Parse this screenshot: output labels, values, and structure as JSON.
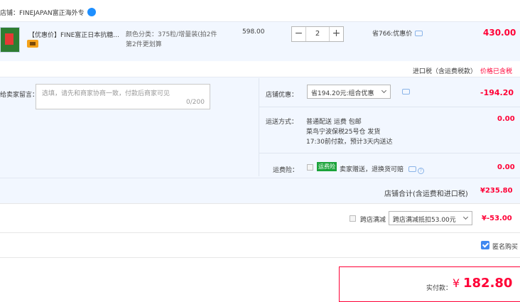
{
  "store": {
    "name": "店铺：FINEJAPAN富正海外专"
  },
  "item": {
    "title": "【优惠价】FINE富正日本抗糖...",
    "sku_line1": "颜色分类：375粒/增量装(拍2件",
    "sku_line2": "第2件更划算",
    "unit_price": "598.00",
    "quantity": "2",
    "minus_label": "−",
    "plus_label": "+",
    "saving": "省766:优惠价",
    "total": "430.00"
  },
  "tax": {
    "label": "进口税（含运费税款）",
    "value": "价格已含税"
  },
  "message": {
    "label": "给卖家留言：",
    "placeholder": "选填，请先和商家协商一致，付款后商家可见",
    "counter": "0/200"
  },
  "coupon": {
    "label": "店铺优惠：",
    "selected": "省194.20元:组合优惠",
    "value": "-194.20"
  },
  "shipping": {
    "label": "运送方式：",
    "line1": "普通配送 运费 包邮",
    "line2": "菜鸟宁波保税25号仓   发货",
    "line3": "17:30前付款，预计3天内送达",
    "value": "0.00"
  },
  "insurance": {
    "label": "运费险：",
    "badge": "运费险",
    "text": "卖家赠送，退换货可赔",
    "value": "0.00"
  },
  "subtotal": {
    "label": "店铺合计(含运费和进口税)",
    "value": "¥235.80"
  },
  "cross_store": {
    "label": "跨店满减",
    "selected": "跨店满减抵扣53.00元",
    "value": "¥-53.00"
  },
  "anonymous": {
    "label": "匿名购买",
    "checked": true
  },
  "payment": {
    "label": "实付款：",
    "currency": "¥",
    "amount": "182.80"
  },
  "colors": {
    "accent": "#ff0036",
    "row_bg": "#f2f7ff",
    "check_blue": "#3f88f0"
  }
}
